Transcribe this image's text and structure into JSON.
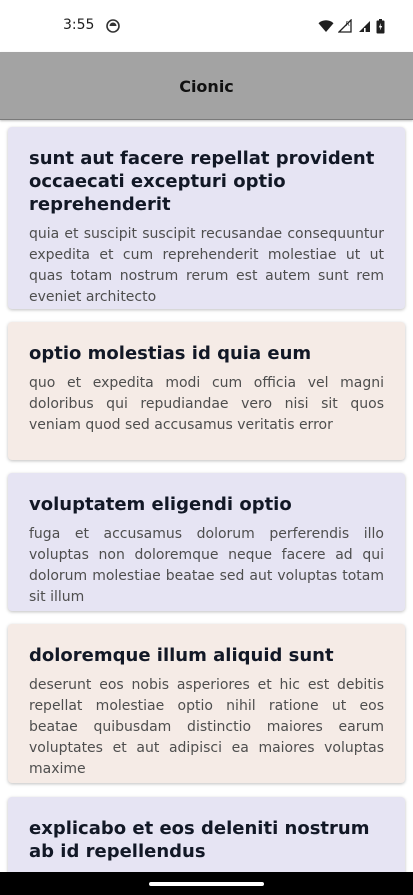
{
  "status_bar": {
    "time": "3:55",
    "icons": [
      "app-notification-icon",
      "wifi-icon",
      "signal-roaming-icon",
      "signal-icon",
      "battery-icon"
    ]
  },
  "app_bar": {
    "title": "Cionic"
  },
  "posts": [
    {
      "title": "sunt aut facere repellat provident occaecati excepturi optio reprehenderit",
      "body": "quia et suscipit suscipit recusandae consequuntur expedita et cum reprehenderit molestiae ut ut quas totam nostrum rerum est autem sunt rem eveniet architecto",
      "color": "#e6e4f3"
    },
    {
      "title": "optio molestias id quia eum",
      "body": "quo et expedita modi cum officia vel magni doloribus qui repudiandae vero nisi sit quos veniam quod sed accusamus veritatis error",
      "color": "#f5ebe6"
    },
    {
      "title": "voluptatem eligendi optio",
      "body": "fuga et accusamus dolorum perferendis illo voluptas non doloremque neque facere ad qui dolorum molestiae beatae sed aut voluptas totam sit illum",
      "color": "#e6e4f3"
    },
    {
      "title": "doloremque illum aliquid sunt",
      "body": "deserunt eos nobis asperiores et hic est debitis repellat molestiae optio nihil ratione ut eos beatae quibusdam distinctio maiores earum voluptates et aut adipisci ea maiores voluptas maxime",
      "color": "#f5ebe6"
    },
    {
      "title": "explicabo et eos deleniti nostrum ab id repellendus",
      "body": "",
      "color": "#e6e4f3"
    }
  ]
}
